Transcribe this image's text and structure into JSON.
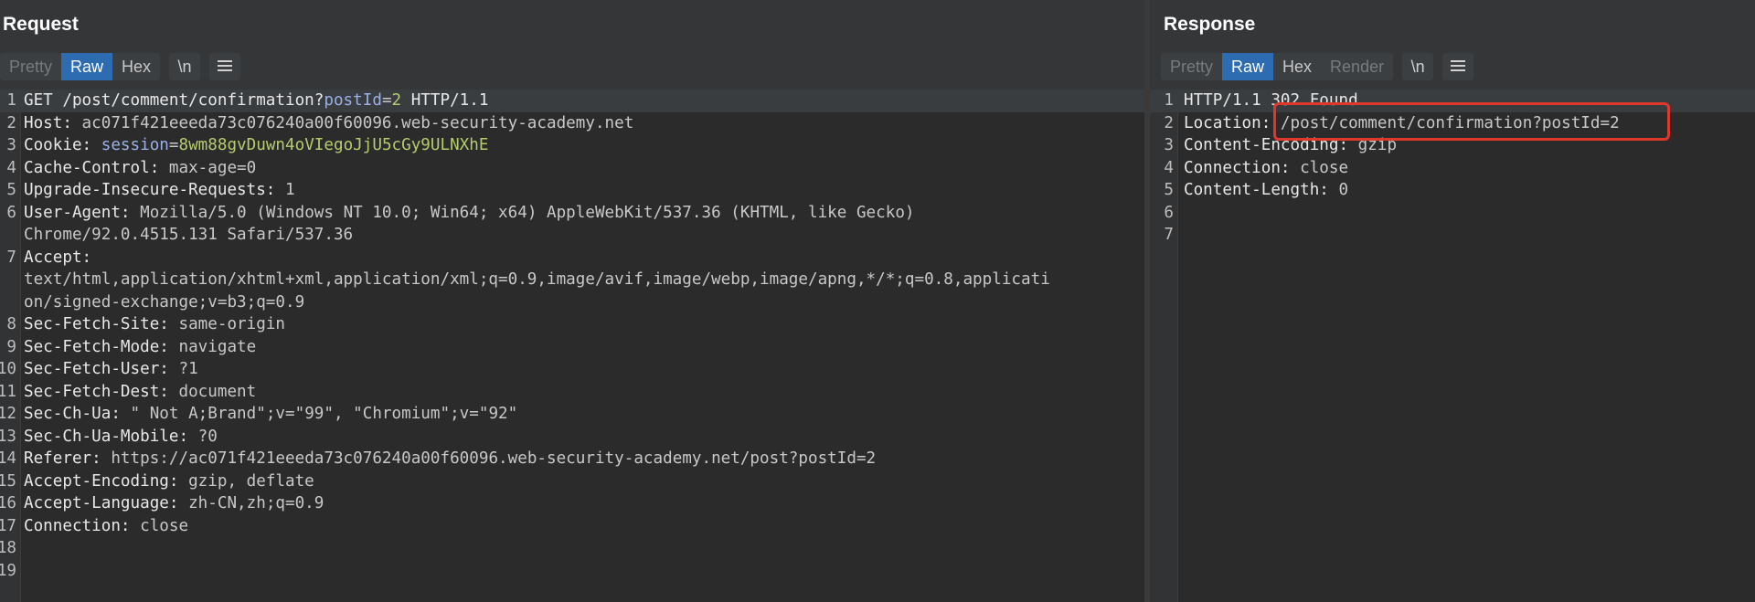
{
  "request": {
    "title": "Request",
    "tabs": [
      "Pretty",
      "Raw",
      "Hex"
    ],
    "newline_label": "\\n",
    "menu_icon": "hamburger-menu-icon",
    "lines": [
      {
        "n": "1",
        "text": "GET /post/comment/confirmation?postId=2 HTTP/1.1"
      },
      {
        "n": "2",
        "key": "Host:",
        "val": " ac071f421eeeda73c076240a00f60096.web-security-academy.net"
      },
      {
        "n": "3",
        "key": "Cookie:",
        "val": " ",
        "param": "session",
        "eq": "=",
        "pval": "8wm88gvDuwn4oVIegoJjU5cGy9ULNXhE"
      },
      {
        "n": "4",
        "key": "Cache-Control:",
        "val": " max-age=0"
      },
      {
        "n": "5",
        "key": "Upgrade-Insecure-Requests:",
        "val": " 1"
      },
      {
        "n": "6",
        "key": "User-Agent:",
        "val": " Mozilla/5.0 (Windows NT 10.0; Win64; x64) AppleWebKit/537.36 (KHTML, like Gecko)"
      },
      {
        "n": "",
        "val": "Chrome/92.0.4515.131 Safari/537.36"
      },
      {
        "n": "7",
        "key": "Accept:",
        "val": ""
      },
      {
        "n": "",
        "val": "text/html,application/xhtml+xml,application/xml;q=0.9,image/avif,image/webp,image/apng,*/*;q=0.8,applicati"
      },
      {
        "n": "",
        "val": "on/signed-exchange;v=b3;q=0.9"
      },
      {
        "n": "8",
        "key": "Sec-Fetch-Site:",
        "val": " same-origin"
      },
      {
        "n": "9",
        "key": "Sec-Fetch-Mode:",
        "val": " navigate"
      },
      {
        "n": "10",
        "key": "Sec-Fetch-User:",
        "val": " ?1"
      },
      {
        "n": "11",
        "key": "Sec-Fetch-Dest:",
        "val": " document"
      },
      {
        "n": "12",
        "key": "Sec-Ch-Ua:",
        "val": " \" Not A;Brand\";v=\"99\", \"Chromium\";v=\"92\""
      },
      {
        "n": "13",
        "key": "Sec-Ch-Ua-Mobile:",
        "val": " ?0"
      },
      {
        "n": "14",
        "key": "Referer:",
        "val": " https://ac071f421eeeda73c076240a00f60096.web-security-academy.net/post?postId=2"
      },
      {
        "n": "15",
        "key": "Accept-Encoding:",
        "val": " gzip, deflate"
      },
      {
        "n": "16",
        "key": "Accept-Language:",
        "val": " zh-CN,zh;q=0.9"
      },
      {
        "n": "17",
        "key": "Connection:",
        "val": " close"
      },
      {
        "n": "18",
        "val": ""
      },
      {
        "n": "19",
        "val": ""
      }
    ],
    "first_line_parts": {
      "a": "GET /post/comment/confirmation?",
      "param": "postId",
      "eq": "=",
      "pval": "2",
      "b": " HTTP/1.1"
    }
  },
  "response": {
    "title": "Response",
    "tabs": [
      "Pretty",
      "Raw",
      "Hex",
      "Render"
    ],
    "newline_label": "\\n",
    "menu_icon": "hamburger-menu-icon",
    "lines": [
      {
        "n": "1",
        "text": "HTTP/1.1 302 Found"
      },
      {
        "n": "2",
        "key": "Location:",
        "val": " /post/comment/confirmation?postId=2"
      },
      {
        "n": "3",
        "key": "Content-Encoding:",
        "val": " gzip"
      },
      {
        "n": "4",
        "key": "Connection:",
        "val": " close"
      },
      {
        "n": "5",
        "key": "Content-Length:",
        "val": " 0"
      },
      {
        "n": "6",
        "val": ""
      },
      {
        "n": "7",
        "val": ""
      }
    ]
  },
  "colors": {
    "accent": "#2d6cb1",
    "highlight_box": "#e0372b",
    "param": "#9ab0e6",
    "param_value": "#b5cc6e"
  }
}
